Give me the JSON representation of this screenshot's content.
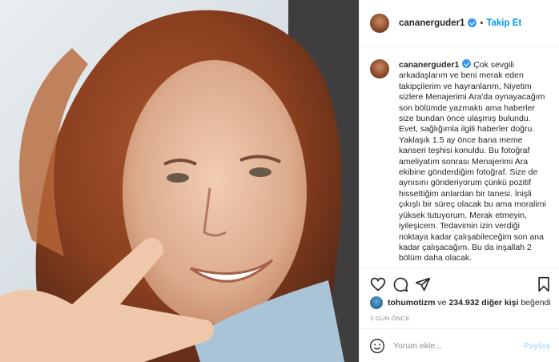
{
  "post": {
    "image_alt": "Selfie of a smiling woman with reddish hair showing a peace sign in a car",
    "author": "cananerguder1",
    "follow_separator": "•",
    "follow_label": "Takip Et"
  },
  "caption": {
    "username": "cananerguder1",
    "text": "Çok sevgili arkadaşlarım ve beni merak eden takipçilerim ve hayranlarım, Niyetim sizlere Menajerimi Ara'da oynayacağım son bölümde yazmaktı ama haberler size bundan önce ulaşmış bulundu. Evet, sağlığımla ilgili haberler doğru. Yaklaşık 1.5 ay önce bana meme kanseri teşhisi konuldu. Bu fotoğraf ameliyatım sonrası Menajerimi Ara ekibine gönderdiğim fotoğraf. Size de aynısını gönderiyorum çünkü pozitif hissettiğim anlardan bir tanesi. İnişli çıkışlı bir süreç olacak bu ama moralimi yüksek tutuyorum. Merak etmeyin, iyileşicem. Tedavimin izin verdiği noktaya kadar çalışabileceğim son ana kadar çalışacağım. Bu da inşallah 2 bölüm daha olacak."
  },
  "likes": {
    "liker": "tohumotizm",
    "connector": "ve",
    "others": "234.932 diğer kişi",
    "suffix": "beğendi"
  },
  "timestamp": "3 GÜN ÖNCE",
  "comment": {
    "placeholder": "Yorum ekle...",
    "share_label": "Paylaş"
  },
  "icons": {
    "like": "heart-icon",
    "comment": "comment-icon",
    "share": "paper-plane-icon",
    "save": "bookmark-icon",
    "emoji": "smiley-icon",
    "verified": "verified-badge-icon"
  },
  "colors": {
    "follow": "#0095f6",
    "verified": "#3897f0",
    "share_disabled": "#b2dffc",
    "muted": "#8e8e8e",
    "text": "#262626"
  }
}
